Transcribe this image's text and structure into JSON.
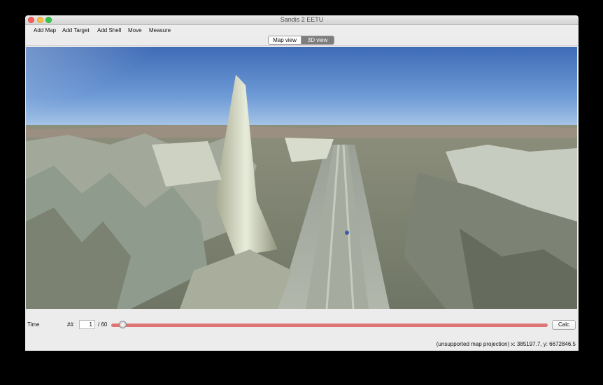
{
  "window": {
    "title": "Sandis 2 EETU"
  },
  "toolbar": {
    "items": [
      "Add Map",
      "Add Target",
      "Add Shell",
      "Move",
      "Measure"
    ]
  },
  "view_toggle": {
    "map_view": "Map view",
    "three_d_view": "3D view",
    "selected": "3D view"
  },
  "timeline": {
    "time_label": "Time",
    "hash_label": "##",
    "current_frame": "1",
    "total_frames": "/ 60",
    "progress_fraction": 0.017,
    "calc_label": "Calc"
  },
  "status": {
    "text": "(unsupported map projection) x: 385197.7, y: 6672846.5"
  },
  "colors": {
    "slider_track": "#e07575",
    "selected_segment": "#7d7d7d"
  }
}
